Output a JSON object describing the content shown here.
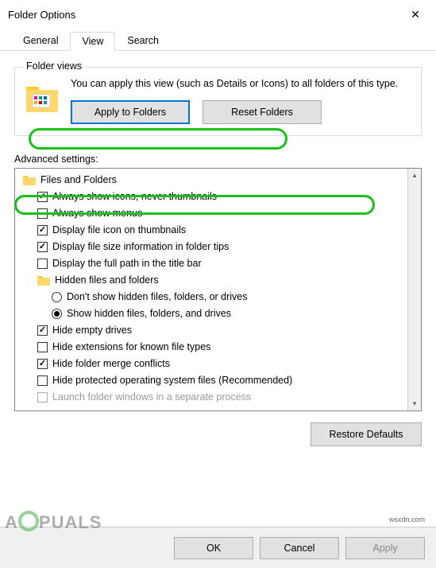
{
  "window": {
    "title": "Folder Options"
  },
  "tabs": [
    {
      "label": "General",
      "active": false
    },
    {
      "label": "View",
      "active": true
    },
    {
      "label": "Search",
      "active": false
    }
  ],
  "folder_views": {
    "legend": "Folder views",
    "description": "You can apply this view (such as Details or Icons) to all folders of this type.",
    "apply_label": "Apply to Folders",
    "reset_label": "Reset Folders"
  },
  "advanced": {
    "label": "Advanced settings:",
    "root": "Files and Folders",
    "items": [
      {
        "kind": "check",
        "checked": true,
        "label": "Always show icons, never thumbnails"
      },
      {
        "kind": "check",
        "checked": false,
        "label": "Always show menus"
      },
      {
        "kind": "check",
        "checked": true,
        "label": "Display file icon on thumbnails"
      },
      {
        "kind": "check",
        "checked": true,
        "label": "Display file size information in folder tips"
      },
      {
        "kind": "check",
        "checked": false,
        "label": "Display the full path in the title bar"
      },
      {
        "kind": "folder",
        "label": "Hidden files and folders"
      },
      {
        "kind": "radio",
        "selected": false,
        "label": "Don't show hidden files, folders, or drives"
      },
      {
        "kind": "radio",
        "selected": true,
        "label": "Show hidden files, folders, and drives",
        "highlight": true
      },
      {
        "kind": "check",
        "checked": true,
        "label": "Hide empty drives"
      },
      {
        "kind": "check",
        "checked": false,
        "label": "Hide extensions for known file types"
      },
      {
        "kind": "check",
        "checked": true,
        "label": "Hide folder merge conflicts"
      },
      {
        "kind": "check",
        "checked": false,
        "label": "Hide protected operating system files (Recommended)",
        "highlight": true
      },
      {
        "kind": "check",
        "checked": false,
        "label": "Launch folder windows in a separate process",
        "cut": true
      }
    ],
    "restore_label": "Restore Defaults"
  },
  "buttons": {
    "ok": "OK",
    "cancel": "Cancel",
    "apply": "Apply"
  },
  "watermark": {
    "text_prefix": "A",
    "text_suffix": "PUALS",
    "byline": "wsxdn.com"
  }
}
